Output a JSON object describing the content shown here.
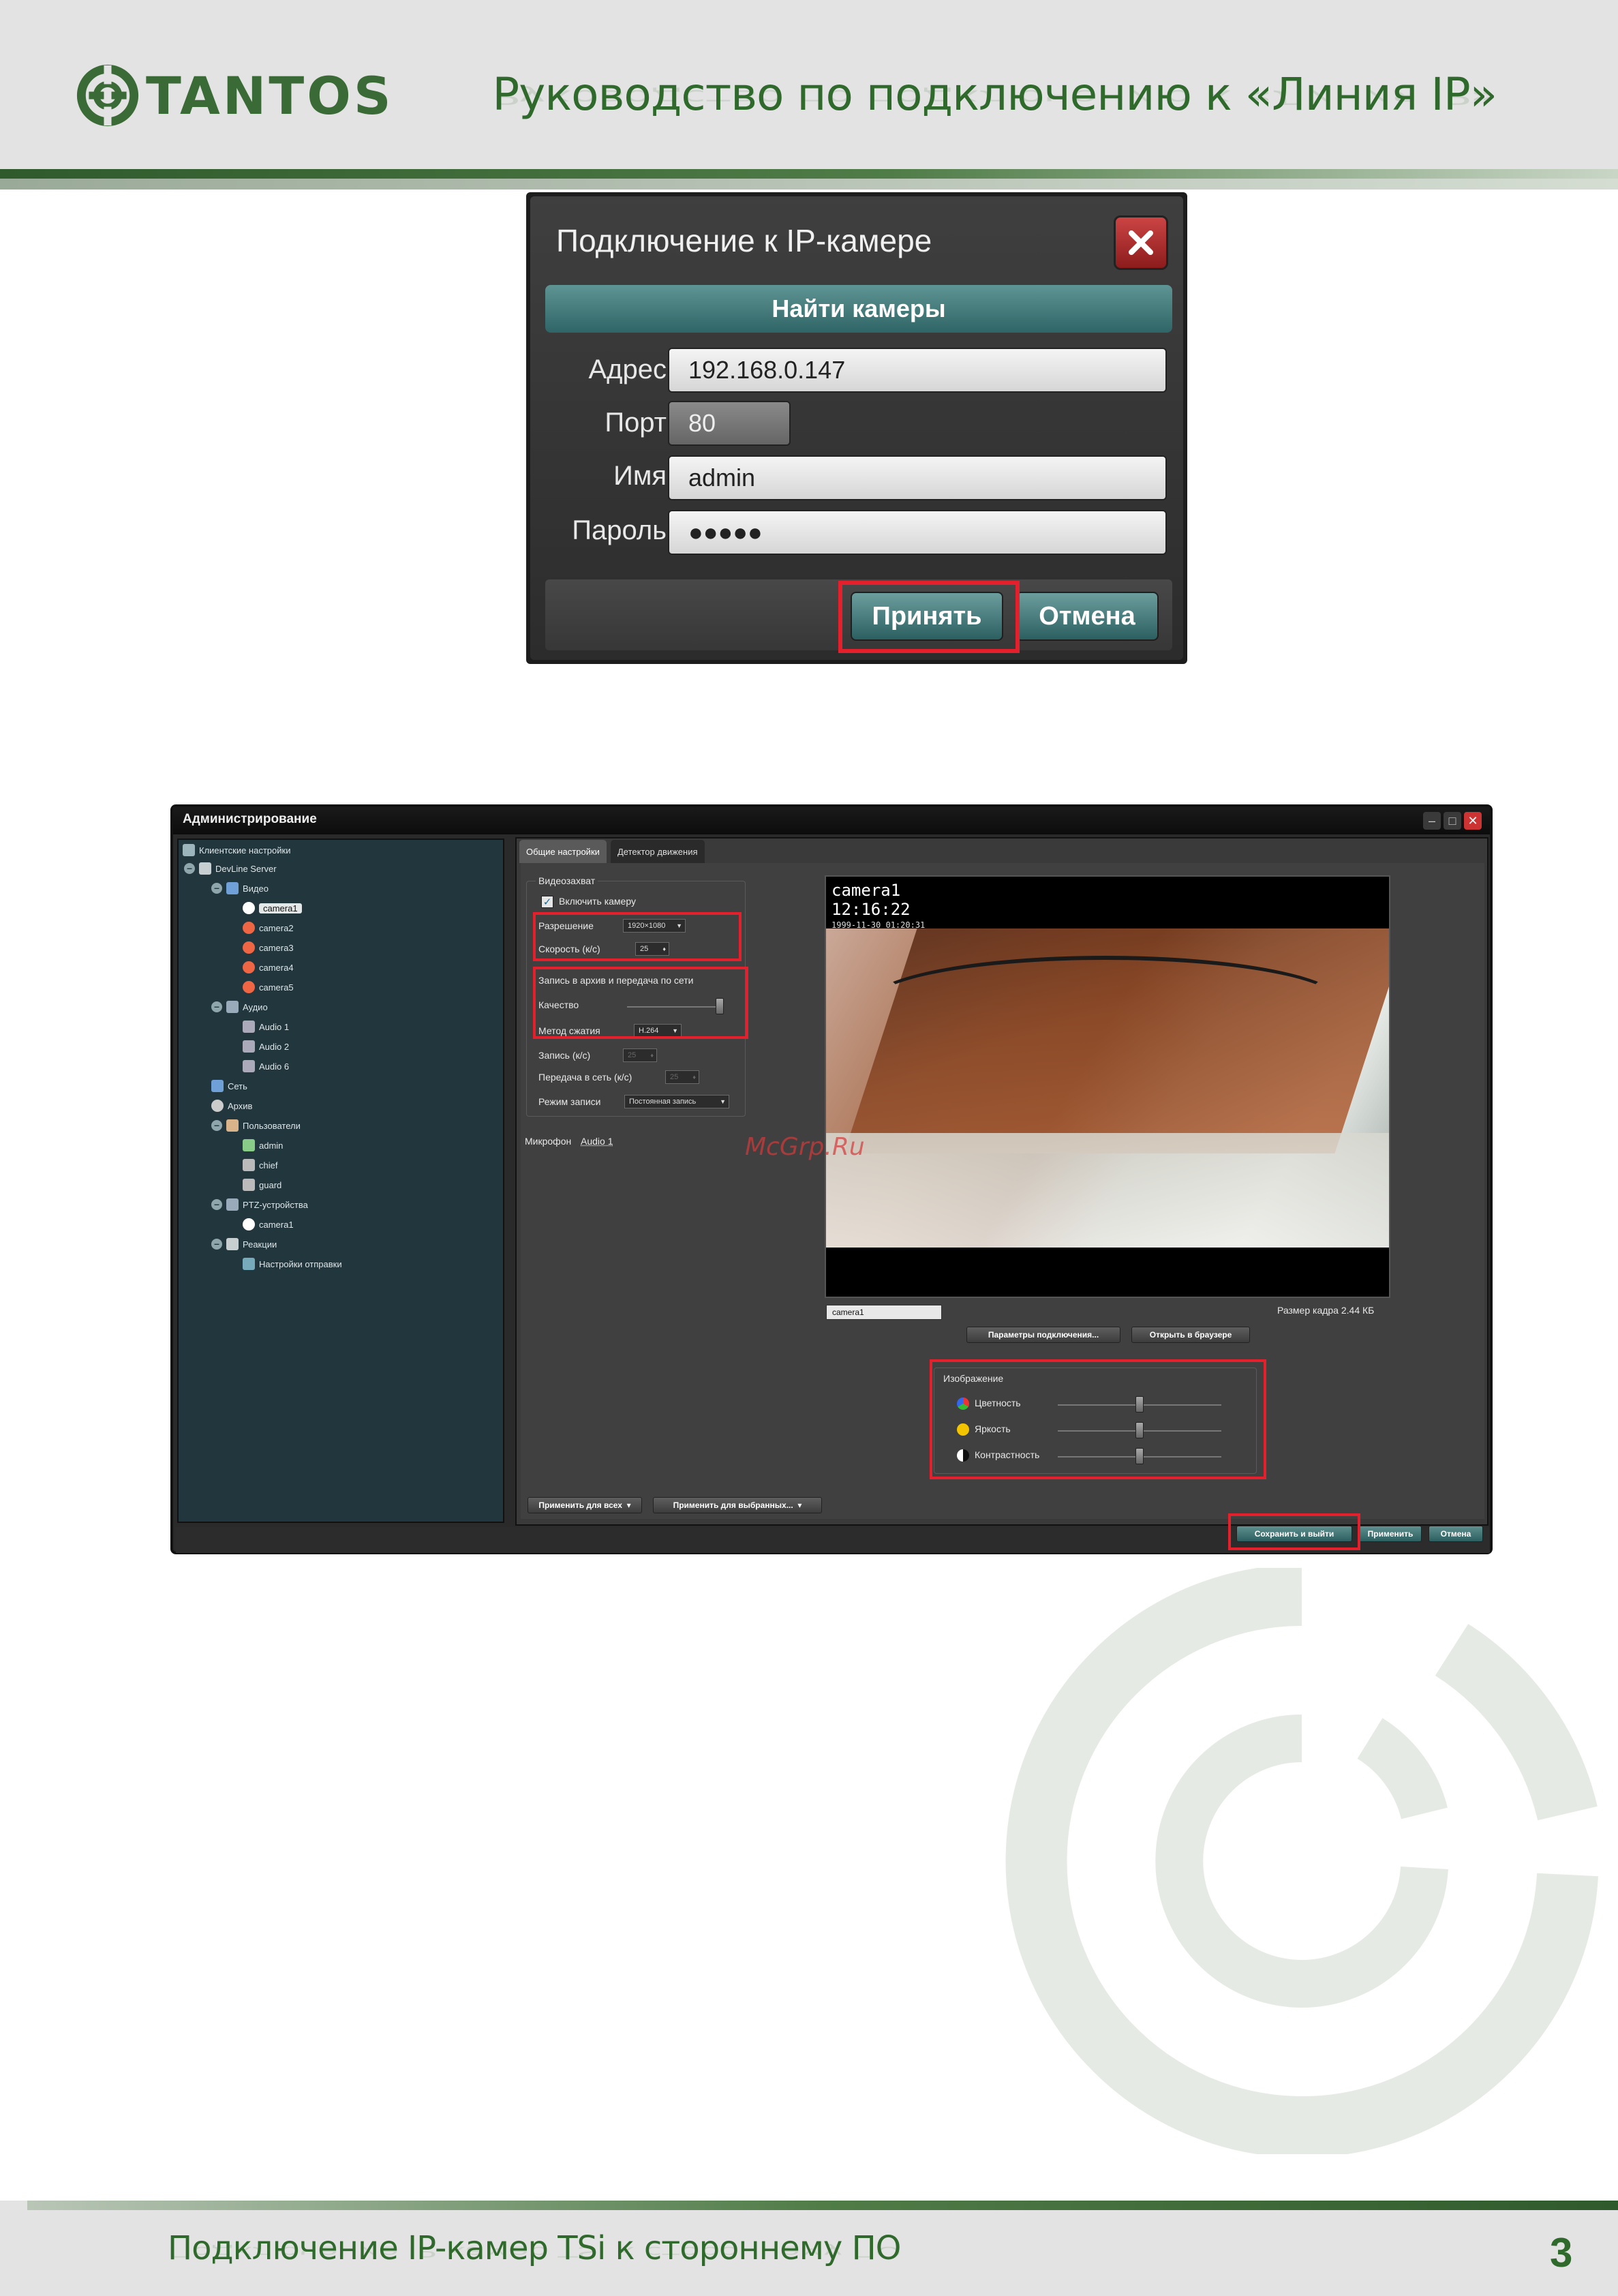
{
  "header": {
    "logo_text": "TANTOS",
    "title": "Руководство по подключению к «Линия IP»"
  },
  "dialog": {
    "title": "Подключение к IP-камере",
    "find_button": "Найти камеры",
    "address_label": "Адрес",
    "address_value": "192.168.0.147",
    "port_label": "Порт",
    "port_value": "80",
    "name_label": "Имя",
    "name_value": "admin",
    "password_label": "Пароль",
    "password_value": "●●●●●",
    "accept_button": "Принять",
    "cancel_button": "Отмена",
    "close_icon": "close-icon",
    "highlight_color": "#e3202b"
  },
  "admin": {
    "title": "Администрирование",
    "tree": {
      "client_settings": "Клиентские настройки",
      "server": "DevLine Server",
      "video": "Видео",
      "cameras": [
        "camera1",
        "camera2",
        "camera3",
        "camera4",
        "camera5"
      ],
      "audio": "Аудио",
      "audio_items": [
        "Audio 1",
        "Audio 2",
        "Audio 6"
      ],
      "network": "Сеть",
      "archive": "Архив",
      "users": "Пользователи",
      "user_items": [
        "admin",
        "chief",
        "guard"
      ],
      "ptz": "PTZ-устройства",
      "ptz_items": [
        "camera1"
      ],
      "reactions": "Реакции",
      "send_settings": "Настройки отправки"
    },
    "tabs": [
      "Общие настройки",
      "Детектор движения"
    ],
    "capture_group": "Видеозахват",
    "enable_camera": "Включить камеру",
    "resolution_label": "Разрешение",
    "resolution_value": "1920×1080",
    "speed_label": "Скорость (к/с)",
    "speed_value": "25",
    "archive_group": "Запись в архив и передача по сети",
    "quality_label": "Качество",
    "compression_label": "Метод сжатия",
    "compression_value": "H.264",
    "record_label": "Запись (к/с)",
    "record_value": "25",
    "network_label": "Передача в сеть (к/с)",
    "network_value": "25",
    "record_mode_label": "Режим записи",
    "record_mode_value": "Постоянная запись",
    "microphone_label": "Микрофон",
    "microphone_value": "Audio 1",
    "video_overlay_name": "camera1",
    "video_overlay_time": "12:16:22",
    "video_osd": "1999-11-30 01:20:31",
    "camera_field": "camera1",
    "frame_size": "Размер кадра 2.44 КБ",
    "conn_params_button": "Параметры подключения...",
    "open_browser_button": "Открыть в браузере",
    "image_group": "Изображение",
    "color_label": "Цветность",
    "brightness_label": "Яркость",
    "contrast_label": "Контрастность",
    "apply_all_button": "Применить для всех",
    "apply_selected_button": "Применить для выбранных...",
    "save_exit_button": "Сохранить и выйти",
    "apply_button": "Применить",
    "cancel_button": "Отмена",
    "watermark": "McGrp.Ru"
  },
  "footer": {
    "text": "Подключение IP-камер TSi к стороннему ПО",
    "page_number": "3"
  },
  "colors": {
    "brand_green": "#2f6a2c",
    "highlight_red": "#e3202b"
  }
}
